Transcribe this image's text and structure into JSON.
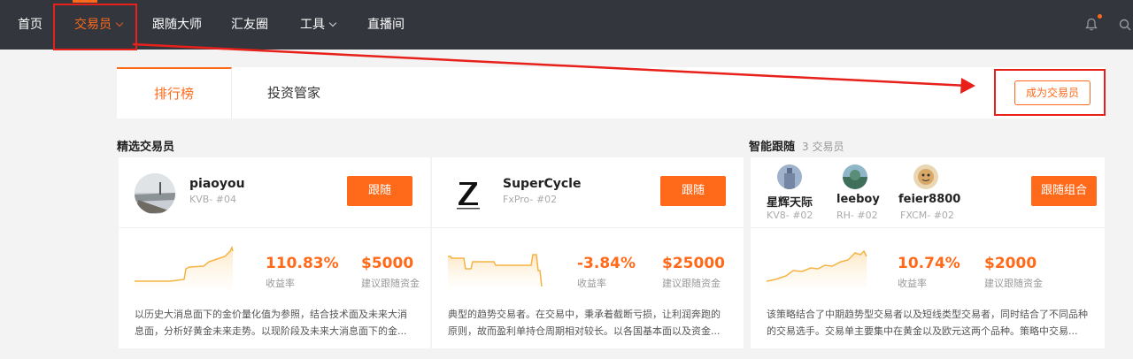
{
  "nav": {
    "items": [
      {
        "label": "首页"
      },
      {
        "label": "交易员"
      },
      {
        "label": "跟随大师"
      },
      {
        "label": "汇友圈"
      },
      {
        "label": "工具"
      },
      {
        "label": "直播间"
      }
    ],
    "accent": "#ff6a1a",
    "bg": "#33363d"
  },
  "tabs": [
    {
      "label": "排行榜"
    },
    {
      "label": "投资管家"
    }
  ],
  "become_trader_label": "成为交易员",
  "featured": {
    "title": "精选交易员",
    "traders": [
      {
        "name": "piaoyou",
        "sub": "KVB- #04",
        "follow": "跟随",
        "return_value": "110.83%",
        "return_label": "收益率",
        "fund_value": "$5000",
        "fund_label": "建议跟随资金",
        "desc": "以历史大消息面下的金价量化值为参照，结合技术面及未来大消息面，分析好黄金未来走势。以现阶段及未来大消息面下的金..."
      },
      {
        "name": "SuperCycle",
        "sub": "FxPro- #02",
        "follow": "跟随",
        "return_value": "-3.84%",
        "return_label": "收益率",
        "fund_value": "$25000",
        "fund_label": "建议跟随资金",
        "desc": "典型的趋势交易者。在交易中，秉承着截断亏损，让利润奔跑的原则，故而盈利单持仓周期相对较长。以各国基本面以及资金..."
      }
    ]
  },
  "smart": {
    "title": "智能跟随",
    "count": "3 交易员",
    "members": [
      {
        "name": "星辉天际",
        "sub": "KV8- #02"
      },
      {
        "name": "leeboy",
        "sub": "RH- #02"
      },
      {
        "name": "feier8800",
        "sub": "FXCM- #02"
      }
    ],
    "follow": "跟随组合",
    "return_value": "10.74%",
    "return_label": "收益率",
    "fund_value": "$2000",
    "fund_label": "建议跟随资金",
    "desc": "该策略结合了中期趋势型交易者以及短线类型交易者，同时结合了不同品种的交易选手。交易单主要集中在黄金以及欧元这两个品种。策略中交易..."
  }
}
